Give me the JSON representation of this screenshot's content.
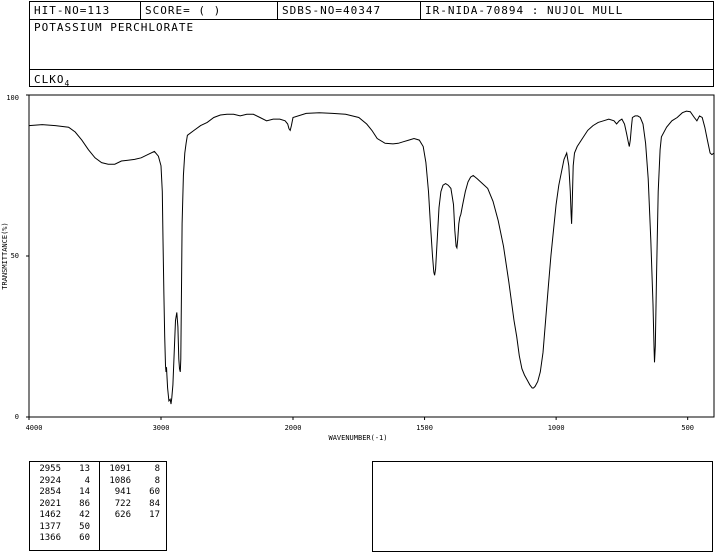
{
  "header": {
    "hit_no": "HIT-NO=113",
    "score": "SCORE=  (  )",
    "sdbs_no": "SDBS-NO=40347",
    "ir_info": "IR-NIDA-70894 : NUJOL MULL",
    "compound_name": "POTASSIUM PERCHLORATE",
    "formula_main": "CLKO",
    "formula_sub": "4"
  },
  "chart_data": {
    "type": "line",
    "xlabel": "WAVENUMBER(-1)",
    "ylabel": "TRANSMITTANCE(%)",
    "xlim": [
      4000,
      400
    ],
    "ylim": [
      0,
      100
    ],
    "x_ticks": [
      4000,
      3000,
      2000,
      1500,
      1000,
      500
    ],
    "y_ticks": [
      0,
      50,
      100
    ],
    "grid": false,
    "line_color": "#000000",
    "series": [
      {
        "points": [
          [
            4000,
            90.5
          ],
          [
            3900,
            90.8
          ],
          [
            3800,
            90.5
          ],
          [
            3700,
            90.0
          ],
          [
            3650,
            88.5
          ],
          [
            3600,
            86.0
          ],
          [
            3550,
            83.0
          ],
          [
            3500,
            80.5
          ],
          [
            3450,
            79.0
          ],
          [
            3400,
            78.5
          ],
          [
            3350,
            78.5
          ],
          [
            3300,
            79.5
          ],
          [
            3200,
            80.0
          ],
          [
            3150,
            80.5
          ],
          [
            3100,
            81.5
          ],
          [
            3050,
            82.5
          ],
          [
            3020,
            81.0
          ],
          [
            3000,
            78.0
          ],
          [
            2990,
            70.0
          ],
          [
            2985,
            55.0
          ],
          [
            2978,
            38.0
          ],
          [
            2972,
            25.0
          ],
          [
            2966,
            16.0
          ],
          [
            2962,
            14.0
          ],
          [
            2958,
            15.5
          ],
          [
            2955,
            13.0
          ],
          [
            2950,
            9.0
          ],
          [
            2940,
            5.0
          ],
          [
            2930,
            5.5
          ],
          [
            2924,
            4.0
          ],
          [
            2918,
            6.0
          ],
          [
            2910,
            10.0
          ],
          [
            2900,
            20.0
          ],
          [
            2890,
            30.0
          ],
          [
            2880,
            32.5
          ],
          [
            2872,
            28.0
          ],
          [
            2865,
            18.0
          ],
          [
            2860,
            15.0
          ],
          [
            2854,
            14.0
          ],
          [
            2850,
            18.0
          ],
          [
            2845,
            40.0
          ],
          [
            2840,
            60.0
          ],
          [
            2830,
            75.0
          ],
          [
            2820,
            82.0
          ],
          [
            2810,
            85.0
          ],
          [
            2800,
            87.5
          ],
          [
            2750,
            89.0
          ],
          [
            2700,
            90.5
          ],
          [
            2650,
            91.5
          ],
          [
            2600,
            93.0
          ],
          [
            2550,
            93.8
          ],
          [
            2500,
            94.0
          ],
          [
            2450,
            94.0
          ],
          [
            2400,
            93.5
          ],
          [
            2350,
            94.0
          ],
          [
            2300,
            94.0
          ],
          [
            2250,
            93.0
          ],
          [
            2200,
            92.0
          ],
          [
            2150,
            92.5
          ],
          [
            2100,
            92.5
          ],
          [
            2060,
            92.0
          ],
          [
            2040,
            91.0
          ],
          [
            2030,
            89.5
          ],
          [
            2021,
            89.0
          ],
          [
            2012,
            90.5
          ],
          [
            2000,
            93.0
          ],
          [
            1950,
            94.3
          ],
          [
            1900,
            94.5
          ],
          [
            1850,
            94.3
          ],
          [
            1800,
            94.0
          ],
          [
            1750,
            93.0
          ],
          [
            1720,
            91.0
          ],
          [
            1700,
            89.0
          ],
          [
            1680,
            86.5
          ],
          [
            1650,
            85.0
          ],
          [
            1620,
            84.8
          ],
          [
            1600,
            85.0
          ],
          [
            1580,
            85.5
          ],
          [
            1560,
            86.0
          ],
          [
            1540,
            86.5
          ],
          [
            1520,
            86.0
          ],
          [
            1505,
            84.0
          ],
          [
            1495,
            79.0
          ],
          [
            1485,
            70.0
          ],
          [
            1478,
            60.0
          ],
          [
            1470,
            50.0
          ],
          [
            1465,
            45.0
          ],
          [
            1462,
            44.0
          ],
          [
            1458,
            46.0
          ],
          [
            1452,
            55.0
          ],
          [
            1445,
            65.0
          ],
          [
            1438,
            70.0
          ],
          [
            1430,
            72.0
          ],
          [
            1420,
            72.5
          ],
          [
            1410,
            72.0
          ],
          [
            1400,
            71.0
          ],
          [
            1390,
            66.0
          ],
          [
            1385,
            58.0
          ],
          [
            1380,
            53.0
          ],
          [
            1377,
            52.5
          ],
          [
            1374,
            55.0
          ],
          [
            1370,
            60.0
          ],
          [
            1366,
            62.0
          ],
          [
            1362,
            63.0
          ],
          [
            1355,
            66.0
          ],
          [
            1345,
            70.0
          ],
          [
            1335,
            73.0
          ],
          [
            1325,
            74.5
          ],
          [
            1315,
            75.0
          ],
          [
            1300,
            74.0
          ],
          [
            1280,
            72.5
          ],
          [
            1260,
            71.0
          ],
          [
            1240,
            67.0
          ],
          [
            1220,
            61.0
          ],
          [
            1200,
            53.0
          ],
          [
            1180,
            42.0
          ],
          [
            1160,
            30.0
          ],
          [
            1150,
            25.0
          ],
          [
            1140,
            19.0
          ],
          [
            1130,
            15.0
          ],
          [
            1120,
            13.0
          ],
          [
            1110,
            11.5
          ],
          [
            1100,
            10.0
          ],
          [
            1091,
            9.0
          ],
          [
            1086,
            9.0
          ],
          [
            1080,
            9.5
          ],
          [
            1070,
            11.0
          ],
          [
            1060,
            14.0
          ],
          [
            1050,
            20.0
          ],
          [
            1040,
            30.0
          ],
          [
            1030,
            40.0
          ],
          [
            1020,
            50.0
          ],
          [
            1010,
            58.0
          ],
          [
            1000,
            66.0
          ],
          [
            990,
            72.0
          ],
          [
            980,
            76.0
          ],
          [
            970,
            80.0
          ],
          [
            960,
            82.0
          ],
          [
            952,
            78.0
          ],
          [
            946,
            70.0
          ],
          [
            943,
            63.0
          ],
          [
            941,
            60.0
          ],
          [
            939,
            66.0
          ],
          [
            935,
            78.0
          ],
          [
            930,
            82.0
          ],
          [
            920,
            84.0
          ],
          [
            900,
            86.5
          ],
          [
            880,
            89.0
          ],
          [
            860,
            90.5
          ],
          [
            840,
            91.5
          ],
          [
            820,
            92.0
          ],
          [
            800,
            92.5
          ],
          [
            780,
            92.0
          ],
          [
            770,
            91.0
          ],
          [
            760,
            92.0
          ],
          [
            750,
            92.5
          ],
          [
            740,
            91.0
          ],
          [
            732,
            88.0
          ],
          [
            726,
            85.5
          ],
          [
            722,
            84.0
          ],
          [
            718,
            86.0
          ],
          [
            714,
            90.0
          ],
          [
            710,
            93.0
          ],
          [
            700,
            93.5
          ],
          [
            690,
            93.5
          ],
          [
            680,
            93.0
          ],
          [
            670,
            91.0
          ],
          [
            660,
            85.0
          ],
          [
            650,
            74.0
          ],
          [
            640,
            55.0
          ],
          [
            632,
            35.0
          ],
          [
            628,
            22.0
          ],
          [
            626,
            17.0
          ],
          [
            623,
            22.0
          ],
          [
            618,
            45.0
          ],
          [
            612,
            70.0
          ],
          [
            605,
            83.0
          ],
          [
            600,
            87.0
          ],
          [
            580,
            90.0
          ],
          [
            560,
            92.0
          ],
          [
            540,
            93.0
          ],
          [
            520,
            94.5
          ],
          [
            505,
            95.0
          ],
          [
            490,
            94.8
          ],
          [
            475,
            93.0
          ],
          [
            465,
            92.0
          ],
          [
            455,
            93.5
          ],
          [
            445,
            93.0
          ],
          [
            435,
            90.0
          ],
          [
            425,
            86.0
          ],
          [
            415,
            82.0
          ],
          [
            408,
            81.5
          ],
          [
            400,
            82.0
          ]
        ]
      }
    ]
  },
  "peak_table": {
    "columns": [
      [
        {
          "wn": "2955",
          "t": "13"
        },
        {
          "wn": "2924",
          "t": "4"
        },
        {
          "wn": "2854",
          "t": "14"
        },
        {
          "wn": "2021",
          "t": "86"
        },
        {
          "wn": "1462",
          "t": "42"
        },
        {
          "wn": "1377",
          "t": "50"
        },
        {
          "wn": "1366",
          "t": "60"
        }
      ],
      [
        {
          "wn": "1091",
          "t": "8"
        },
        {
          "wn": "1086",
          "t": "8"
        },
        {
          "wn": "941",
          "t": "60"
        },
        {
          "wn": "722",
          "t": "84"
        },
        {
          "wn": "626",
          "t": "17"
        }
      ]
    ]
  }
}
